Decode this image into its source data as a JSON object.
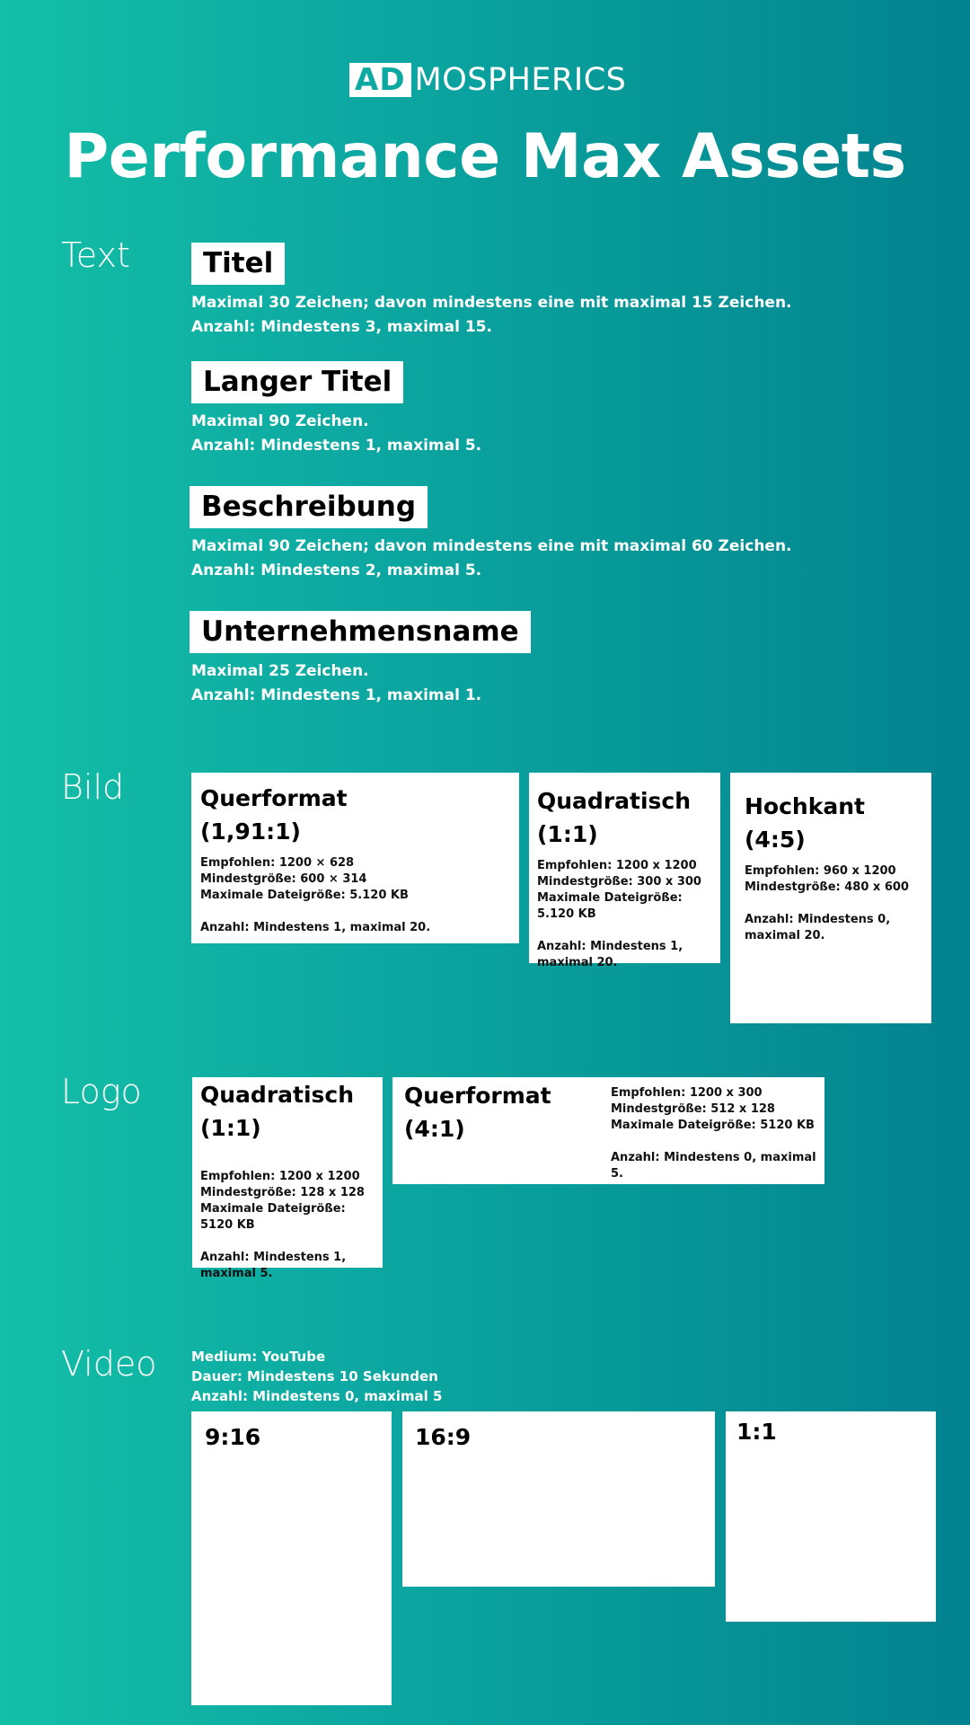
{
  "brand": {
    "logo_boxed": "AD",
    "logo_rest": "MOSPHERICS"
  },
  "title": "Performance Max Assets",
  "colors": {
    "gradient_start": "#13BFA6",
    "gradient_end": "#03828F",
    "card_bg": "#FFFFFF",
    "text_light": "#FFFFFF",
    "text_dark": "#000000"
  },
  "sections": {
    "text": {
      "label": "Text",
      "items": [
        {
          "name": "Titel",
          "line1": "Maximal 30 Zeichen; davon mindestens eine mit maximal 15 Zeichen.",
          "line2": "Anzahl: Mindestens 3, maximal 15."
        },
        {
          "name": "Langer Titel",
          "line1": "Maximal 90 Zeichen.",
          "line2": "Anzahl: Mindestens 1, maximal 5."
        },
        {
          "name": "Beschreibung",
          "line1": "Maximal 90 Zeichen; davon mindestens eine mit maximal 60 Zeichen.",
          "line2": "Anzahl: Mindestens 2, maximal 5."
        },
        {
          "name": "Unternehmensname",
          "line1": "Maximal 25 Zeichen.",
          "line2": "Anzahl: Mindestens 1, maximal 1."
        }
      ]
    },
    "bild": {
      "label": "Bild",
      "cards": [
        {
          "title1": "Querformat",
          "title2": "(1,91:1)",
          "recommended": "Empfohlen: 1200 × 628",
          "min_size": "Mindestgröße: 600 × 314",
          "max_file": "Maximale Dateigröße: 5.120 KB",
          "count": "Anzahl: Mindestens 1, maximal 20."
        },
        {
          "title1": "Quadratisch",
          "title2": "(1:1)",
          "recommended": "Empfohlen: 1200 x 1200",
          "min_size": "Mindestgröße: 300 x 300",
          "max_file": "Maximale Dateigröße: 5.120 KB",
          "count_a": "Anzahl: Mindestens 1,",
          "count_b": "maximal 20."
        },
        {
          "title1": "Hochkant",
          "title2": "(4:5)",
          "recommended": "Empfohlen: 960 x 1200",
          "min_size": "Mindestgröße: 480 x 600",
          "count_a": "Anzahl: Mindestens 0,",
          "count_b": "maximal 20."
        }
      ]
    },
    "logo": {
      "label": "Logo",
      "cards": [
        {
          "title1": "Quadratisch",
          "title2": "(1:1)",
          "recommended": "Empfohlen: 1200 x 1200",
          "min_size": "Mindestgröße: 128 x 128",
          "max_file": "Maximale Dateigröße: 5120 KB",
          "count_a": "Anzahl: Mindestens 1,",
          "count_b": "maximal 5."
        },
        {
          "title1": "Querformat",
          "title2": "(4:1)",
          "recommended": "Empfohlen: 1200 x 300",
          "min_size": "Mindestgröße: 512 x 128",
          "max_file": "Maximale Dateigröße: 5120 KB",
          "count": "Anzahl: Mindestens 0, maximal 5."
        }
      ]
    },
    "video": {
      "label": "Video",
      "medium": "Medium: YouTube",
      "duration": "Dauer: Mindestens 10 Sekunden",
      "count": "Anzahl: Mindestens 0, maximal 5",
      "formats": [
        "9:16",
        "16:9",
        "1:1"
      ]
    }
  }
}
